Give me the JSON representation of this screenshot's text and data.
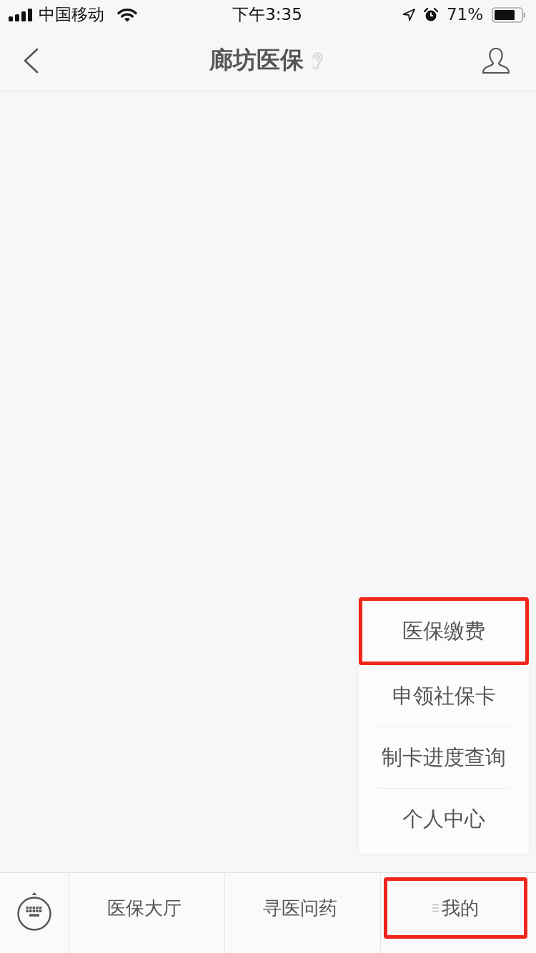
{
  "status_bar": {
    "carrier": "中国移动",
    "time": "下午3:35",
    "battery_percent": "71%"
  },
  "nav_bar": {
    "title": "廊坊医保"
  },
  "popup_menu": {
    "items": [
      {
        "label": "医保缴费",
        "highlighted": true
      },
      {
        "label": "申领社保卡",
        "highlighted": false
      },
      {
        "label": "制卡进度查询",
        "highlighted": false
      },
      {
        "label": "个人中心",
        "highlighted": false
      }
    ]
  },
  "tab_bar": {
    "tabs": [
      {
        "label": "医保大厅",
        "has_submenu": false,
        "highlighted": false
      },
      {
        "label": "寻医问药",
        "has_submenu": false,
        "highlighted": false
      },
      {
        "label": "我的",
        "has_submenu": true,
        "highlighted": true
      }
    ]
  }
}
